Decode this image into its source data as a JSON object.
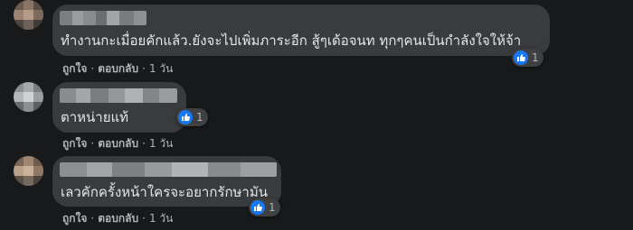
{
  "comments": [
    {
      "text": "ทำงานกะเมื่อยคักแล้ว.ยังจะไปเพิ่มภาระอีก สู้ๆเด้อจนท ทุกๆคนเป็นกำลังใจให้จ้า",
      "reaction_count": "1",
      "like_label": "ถูกใจ",
      "reply_label": "ตอบกลับ",
      "time": "1 วัน",
      "separator": "·"
    },
    {
      "text": "ตาหน่ายแท้",
      "reaction_count": "1",
      "like_label": "ถูกใจ",
      "reply_label": "ตอบกลับ",
      "time": "1 วัน",
      "separator": "·"
    },
    {
      "text": "เลวคักครั้งหน้าใครจะอยากรักษามัน",
      "reaction_count": "1",
      "like_label": "ถูกใจ",
      "reply_label": "ตอบกลับ",
      "time": "1 วัน",
      "separator": "·"
    }
  ],
  "colors": {
    "background": "#18191a",
    "bubble": "#3a3b3c",
    "text": "#e4e6eb",
    "secondary_text": "#b0b3b8",
    "like_blue": "#1877f2"
  },
  "icons": {
    "reaction": "like-thumb-icon",
    "avatar": "pixelated-avatar"
  }
}
